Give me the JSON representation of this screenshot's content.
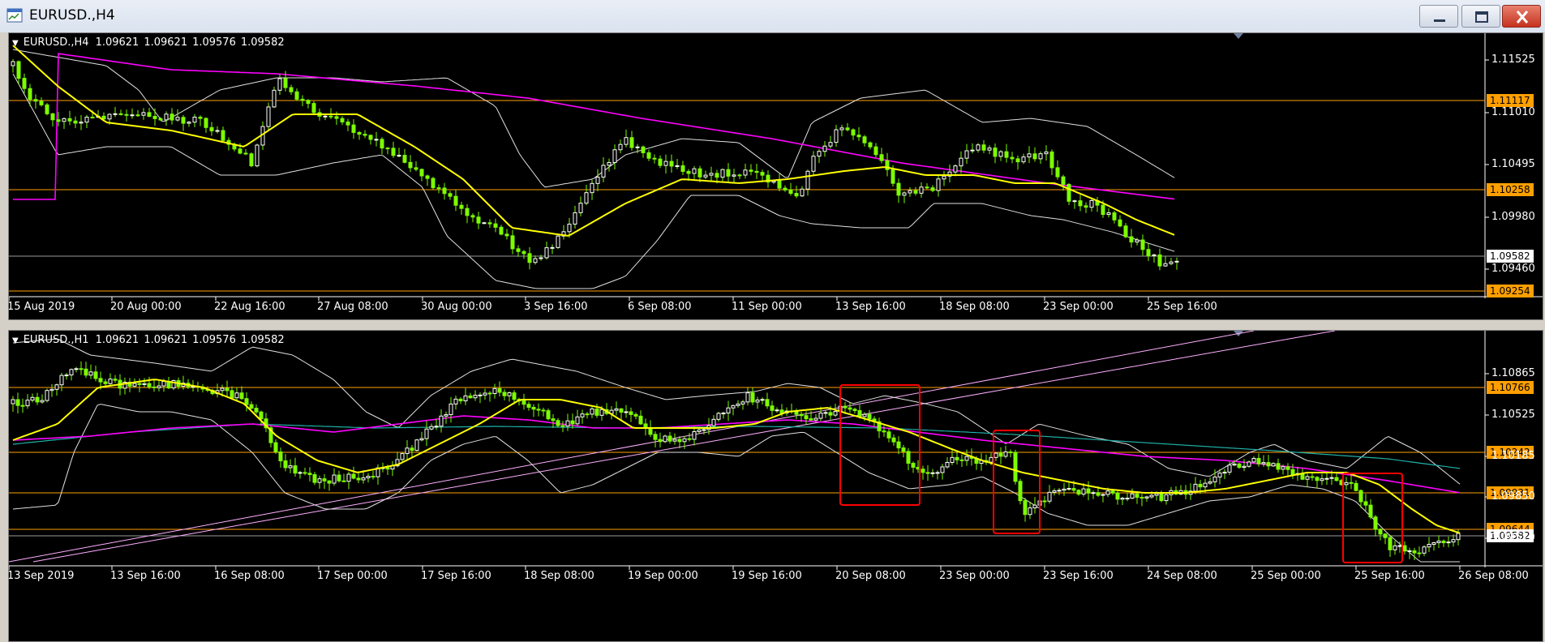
{
  "window": {
    "title": "EURUSD.,H4",
    "icon": "chart-window-icon",
    "buttons": [
      "minimize-icon",
      "maximize-icon",
      "close-icon"
    ]
  },
  "colors": {
    "background": "#000000",
    "candle_up": "#7cfc00",
    "candle_down": "#ffffff",
    "ma_fast": "#ffff00",
    "ma_slow": "#ff00ff",
    "ma_teal": "#20b2aa",
    "bollinger": "#e0e0e0",
    "level_line": "#ff9f00",
    "box": "#ff0000",
    "trend_line": "#ffb0ff"
  },
  "panes": [
    {
      "id": "top",
      "header": {
        "symbol": "EURUSD.,H4",
        "open": "1.09621",
        "high": "1.09621",
        "low": "1.09576",
        "close": "1.09582"
      },
      "price_labels": [
        "1.11525",
        "1.11010",
        "1.10495",
        "1.09980",
        "1.09460"
      ],
      "levels": [
        "1.11117",
        "1.10258",
        "1.09254"
      ],
      "bid": "1.09582",
      "time_labels": [
        "15 Aug 2019",
        "20 Aug 00:00",
        "22 Aug 16:00",
        "27 Aug 08:00",
        "30 Aug 00:00",
        "3 Sep 16:00",
        "6 Sep 08:00",
        "11 Sep 00:00",
        "13 Sep 16:00",
        "18 Sep 08:00",
        "23 Sep 00:00",
        "25 Sep 16:00"
      ]
    },
    {
      "id": "bottom",
      "header": {
        "symbol": "EURUSD.,H1",
        "open": "1.09621",
        "high": "1.09621",
        "low": "1.09576",
        "close": "1.09582"
      },
      "price_labels": [
        "1.10865",
        "1.10525",
        "1.10185",
        "1.09850",
        "1.09510"
      ],
      "levels": [
        "1.10766",
        "1.10242",
        "1.09931",
        "1.09644"
      ],
      "bid": "1.09582",
      "time_labels": [
        "13 Sep 2019",
        "13 Sep 16:00",
        "16 Sep 08:00",
        "17 Sep 00:00",
        "17 Sep 16:00",
        "18 Sep 08:00",
        "19 Sep 00:00",
        "19 Sep 16:00",
        "20 Sep 08:00",
        "23 Sep 00:00",
        "23 Sep 16:00",
        "24 Sep 08:00",
        "25 Sep 00:00",
        "25 Sep 16:00",
        "26 Sep 08:00"
      ]
    }
  ]
}
